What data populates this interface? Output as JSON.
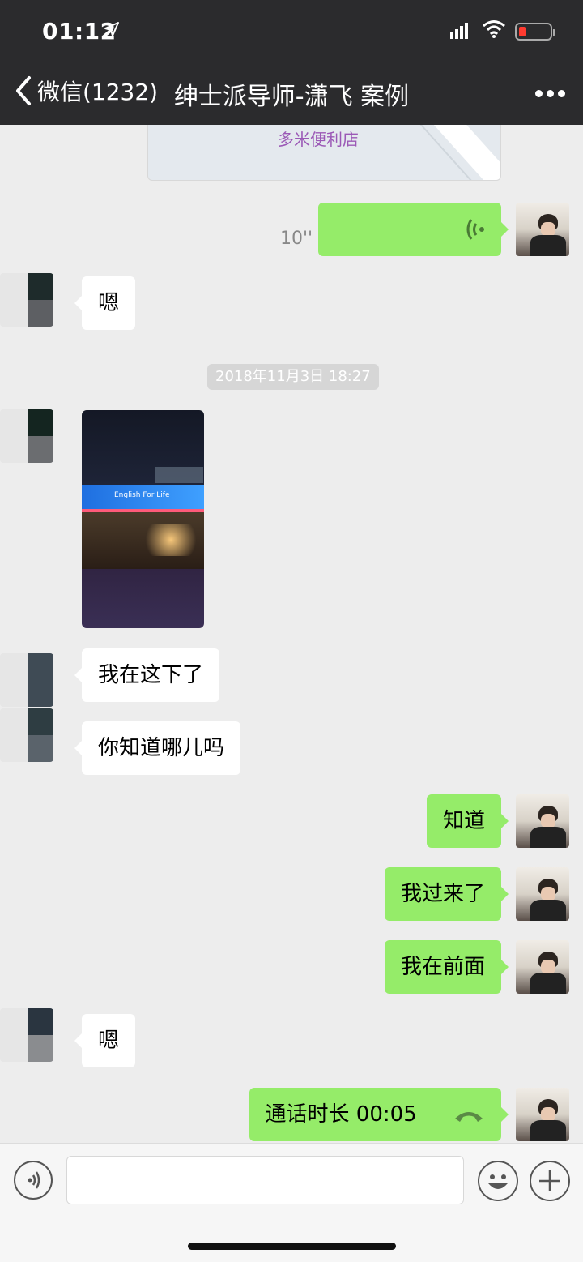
{
  "status_bar": {
    "time": "01:12"
  },
  "nav": {
    "back_label": "微信(1232)",
    "title": "绅士派导师-潇飞 案例"
  },
  "location": {
    "name": "多米便利店"
  },
  "messages": {
    "voice_duration": "10''",
    "msg1": "嗯",
    "timestamp": "2018年11月3日 18:27",
    "msg2": "我在这下了",
    "msg3": "你知道哪儿吗",
    "msg4": "知道",
    "msg5": "我过来了",
    "msg6": "我在前面",
    "msg7": "嗯",
    "msg8": "通话时长 00:05"
  },
  "photo": {
    "sign_text": "English For Life"
  },
  "colors": {
    "header_bg": "#2b2b2d",
    "chat_bg": "#ededed",
    "outgoing_bubble": "#95ec69",
    "incoming_bubble": "#ffffff"
  },
  "icons": [
    "location-arrow-icon",
    "signal-icon",
    "wifi-icon",
    "battery-icon",
    "back-chevron-icon",
    "more-icon",
    "voice-wave-icon",
    "phone-icon",
    "voice-input-icon",
    "emoji-icon",
    "plus-icon"
  ]
}
